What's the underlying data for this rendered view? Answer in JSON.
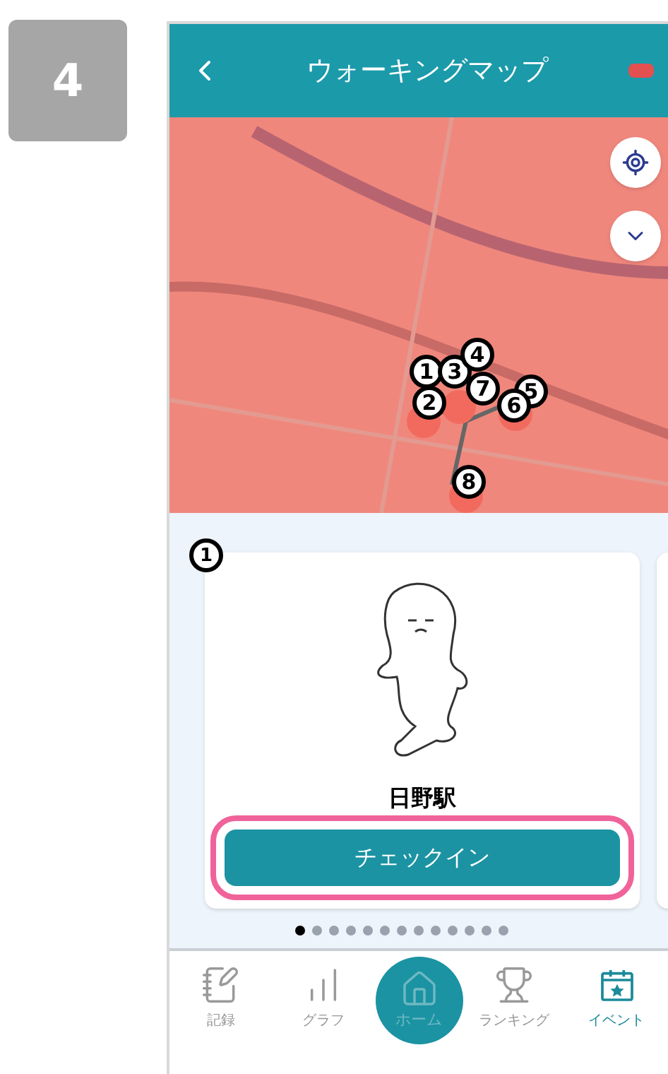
{
  "step": "4",
  "header": {
    "title": "ウォーキングマップ"
  },
  "map": {
    "markers": [
      {
        "label": "1"
      },
      {
        "label": "2"
      },
      {
        "label": "3"
      },
      {
        "label": "4"
      },
      {
        "label": "5"
      },
      {
        "label": "6"
      },
      {
        "label": "7"
      },
      {
        "label": "8"
      }
    ]
  },
  "card": {
    "marker": "1",
    "name": "日野駅",
    "button": "チェックイン"
  },
  "pager": [
    {
      "selected": true
    },
    {
      "selected": false
    },
    {
      "selected": false
    },
    {
      "selected": false
    },
    {
      "selected": false
    },
    {
      "selected": false
    },
    {
      "selected": false
    },
    {
      "selected": false
    },
    {
      "selected": false
    },
    {
      "selected": false
    },
    {
      "selected": false
    },
    {
      "selected": false
    },
    {
      "selected": false
    }
  ],
  "nav": [
    {
      "kind": "record",
      "label": "記録",
      "selected": false
    },
    {
      "kind": "graph",
      "label": "グラフ",
      "selected": false
    },
    {
      "kind": "home",
      "label": "ホーム",
      "selected": false
    },
    {
      "kind": "ranking",
      "label": "ランキング",
      "selected": false
    },
    {
      "kind": "event",
      "label": "イベント",
      "selected": true
    }
  ]
}
